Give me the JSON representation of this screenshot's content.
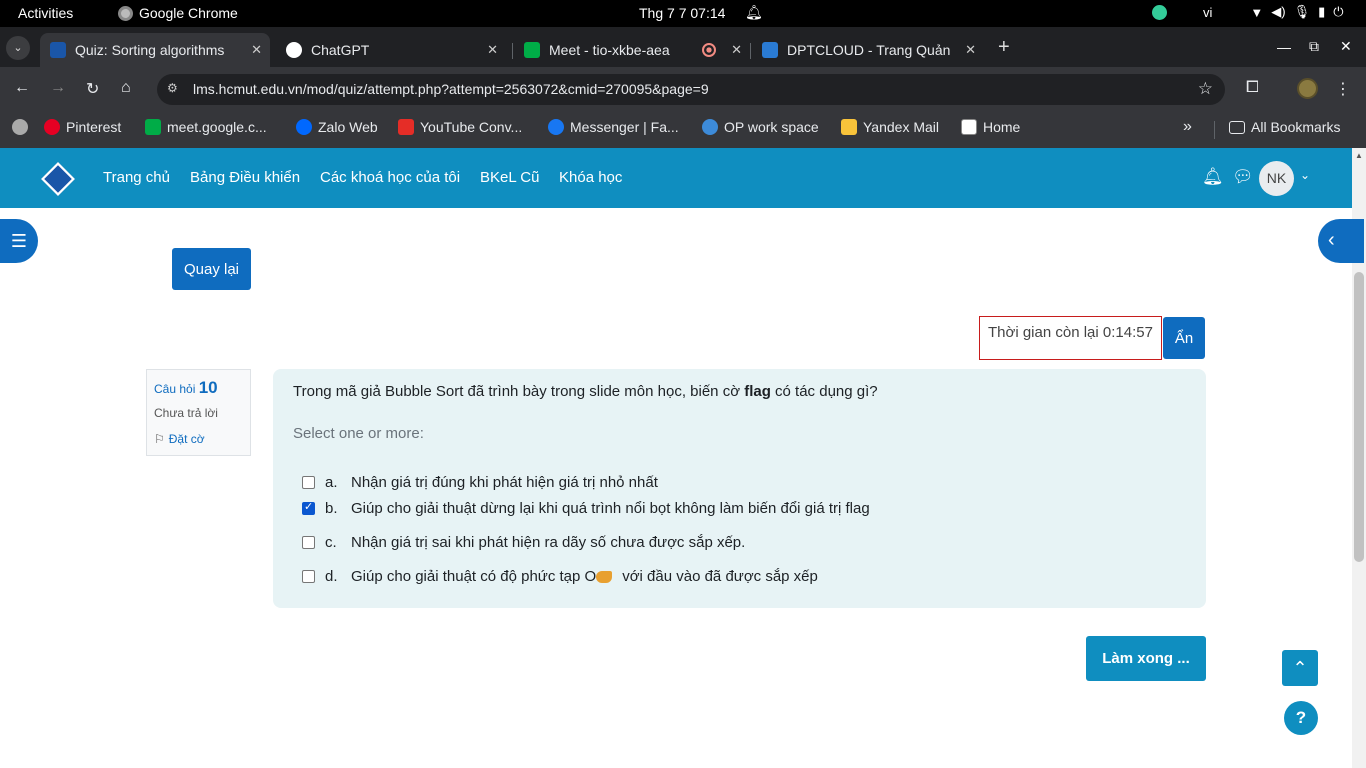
{
  "system": {
    "activities": "Activities",
    "app_name": "Google Chrome",
    "clock": "Thg 7 7  07:14",
    "lang": "vi"
  },
  "tabs": [
    {
      "title": "Quiz: Sorting algorithms",
      "active": true
    },
    {
      "title": "ChatGPT"
    },
    {
      "title": "Meet - tio-xkbe-aea"
    },
    {
      "title": "DPTCLOUD - Trang Quản"
    }
  ],
  "address": {
    "url": "lms.hcmut.edu.vn/mod/quiz/attempt.php?attempt=2563072&cmid=270095&page=9"
  },
  "bookmarks": [
    {
      "label": "Pinterest"
    },
    {
      "label": "meet.google.c..."
    },
    {
      "label": "Zalo Web"
    },
    {
      "label": "YouTube Conv..."
    },
    {
      "label": "Messenger | Fa..."
    },
    {
      "label": "OP work space"
    },
    {
      "label": "Yandex Mail"
    },
    {
      "label": "Home"
    }
  ],
  "bookmarks_more": "»",
  "all_bookmarks": "All Bookmarks",
  "nav": {
    "links": [
      "Trang chủ",
      "Bảng Điều khiển",
      "Các khoá học của tôi",
      "BKeL Cũ",
      "Khóa học"
    ],
    "avatar_initials": "NK"
  },
  "page": {
    "back_button": "Quay lại",
    "timer_label": "Thời gian còn lại 0:14:57",
    "hide_button": "Ẩn",
    "finish_button": "Làm xong ..."
  },
  "question": {
    "label": "Câu hỏi",
    "number": "10",
    "state": "Chưa trả lời",
    "flag": "Đặt cờ",
    "text_before": "Trong mã giả Bubble Sort đã trình bày trong slide môn học, biến cờ ",
    "text_bold": "flag",
    "text_after": " có tác dụng gì?",
    "prompt": "Select one or more:",
    "answers": [
      {
        "letter": "a.",
        "text": "Nhận giá trị đúng khi phát hiện giá trị nhỏ nhất",
        "checked": false
      },
      {
        "letter": "b.",
        "text": "Giúp cho giải thuật dừng lại khi quá trình nổi bọt không làm biến đổi giá trị flag",
        "checked": true
      },
      {
        "letter": "c.",
        "text": "Nhận giá trị sai khi phát hiện ra dãy số chưa được sắp xếp.",
        "checked": false
      },
      {
        "letter": "d.",
        "text_before": "Giúp cho giải thuật có độ phức tạp O",
        "text_after": " với đầu vào đã được sắp xếp",
        "checked": false
      }
    ]
  },
  "colors": {
    "navbar": "#0f8ec0",
    "primary": "#0f6cbf",
    "question_bg": "#e7f3f5",
    "timer_border": "#c71c1c"
  }
}
